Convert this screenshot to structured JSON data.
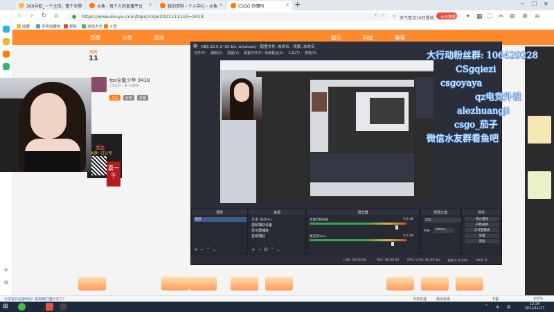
{
  "browser": {
    "tabs": [
      {
        "label": "360导航_一个主页，整个世界",
        "color": "#ffbf2e"
      },
      {
        "label": "斗鱼 - 每个人的直播平台",
        "color": "#ff7a00"
      },
      {
        "label": "我的资料 - 个人中心 - 斗鱼",
        "color": "#ff7a00"
      },
      {
        "label": "CSGO 你懂吗",
        "color": "#ff7a00"
      }
    ],
    "new_tab": "+",
    "url": "https://www.douyu.com/topic/csgo20211111rid=9418",
    "search_placeholder": "天气鲁月19日提档",
    "search_button": "点击搜索",
    "bookmarks": [
      "收藏",
      "手机收藏夹",
      "更新",
      "游戏大全",
      "斗鱼"
    ],
    "window_controls": [
      "─",
      "☐",
      "✕"
    ]
  },
  "douyu": {
    "nav": [
      "直播",
      "分类",
      "游戏",
      "娱乐",
      "科技",
      "赛事"
    ],
    "rank_label": "周榜",
    "rank_value": "11",
    "streamer_name": "fps全能少年 9418",
    "streamer_sub": "CSGO  ·  ★ 1069",
    "room_buttons": [
      "关注",
      "分享",
      "举报"
    ],
    "promo_follow": "关注",
    "promo_sub": "电竞\" 订公号",
    "promo_red": "嘉一千"
  },
  "obs": {
    "title": "OBS 22.0.2 (32-bit, windows) - 配置文件: 未命名 - 场景: 未命名",
    "menu": [
      "文件(F)",
      "编辑(E)",
      "视图(V)",
      "配置文件(P)",
      "场景集合(S)",
      "工具(T)",
      "帮助(H)"
    ],
    "docks": {
      "scenes": {
        "header": "场景",
        "items": [
          "场景"
        ]
      },
      "sources": {
        "header": "来源",
        "items": [
          "文本 (GDI+)",
          "视频捕获设备",
          "显示器捕获",
          "音频捕获"
        ]
      },
      "mixer": {
        "header": "混音器",
        "channels": [
          {
            "name": "桌面音频设备",
            "db": "0.0 dB",
            "level": 0.8
          },
          {
            "name": "麦克风/Aux",
            "db": "0.0 dB",
            "level": 0.75
          }
        ]
      },
      "transitions": {
        "header": "场景过渡",
        "select": "淡出",
        "duration_label": "时长",
        "duration": "300ms"
      },
      "controls": {
        "header": "控件",
        "buttons": [
          "停止推流",
          "开始录制",
          "工作室模式",
          "设置",
          "退出"
        ]
      }
    },
    "status": [
      "LIVE: 00:00:00",
      "REC: 00:00:00",
      "CPU: 0.4%, 60.00 fps",
      "丢帧 0 (0.0%)",
      "kb/s: 0"
    ]
  },
  "overlay": {
    "lines": [
      "大行动粉丝群: 106429228",
      "CSgqiezi",
      "csgoyaya",
      "qz电竞外设",
      "alezhuangji",
      "csgo_茄子",
      "微信水友群看鱼吧"
    ]
  },
  "statusbar": {
    "left": "元宇宙日是游戏吗? 黑和赚扩圈分享了?",
    "items": [
      "今日优选",
      "热点资讯",
      "下载",
      "100%"
    ]
  },
  "taskbar": {
    "time": "12:24",
    "date": "2021/11/17",
    "tray": [
      "^",
      "中",
      "英"
    ]
  }
}
